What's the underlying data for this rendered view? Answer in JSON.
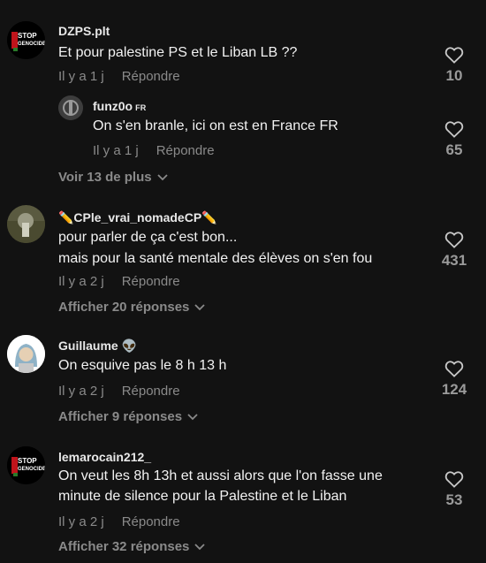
{
  "comments": [
    {
      "username": "DZPS.plt",
      "text_lines": [
        "Et pour palestine PS et le Liban LB ??"
      ],
      "time": "Il y a 1 j",
      "reply": "Répondre",
      "likes": "10",
      "more": "Voir 13 de plus",
      "avatar": "stop-genocide-avatar",
      "reply_item": {
        "username": "funz0o",
        "flag": "FR",
        "text": "On s'en branle, ici on est en France FR",
        "time": "Il y a 1 j",
        "reply": "Répondre",
        "likes": "65"
      }
    },
    {
      "username": "✏️CPle_vrai_nomadeCP✏️",
      "text_lines": [
        "pour parler de ça c'est bon...",
        "mais pour la santé mentale des élèves on s'en fou"
      ],
      "time": "Il y a 2 j",
      "reply": "Répondre",
      "likes": "431",
      "more": "Afficher 20 réponses"
    },
    {
      "username": "Guillaume 👽",
      "text_lines": [
        "On esquive pas le 8 h 13 h"
      ],
      "time": "Il y a 2 j",
      "reply": "Répondre",
      "likes": "124",
      "more": "Afficher 9 réponses"
    },
    {
      "username": "lemarocain212_",
      "text_lines": [
        "On veut les 8h 13h et aussi alors que l'on fasse une",
        "minute de silence pour la Palestine et le Liban"
      ],
      "time": "Il y a 2 j",
      "reply": "Répondre",
      "likes": "53",
      "more": "Afficher 32 réponses"
    }
  ],
  "avatar_text": {
    "line1": "STOP",
    "line2": "GENOCIDE"
  },
  "colors": {
    "background": "#121212",
    "muted": "#8a8a8a",
    "text": "#f2f2f2"
  }
}
